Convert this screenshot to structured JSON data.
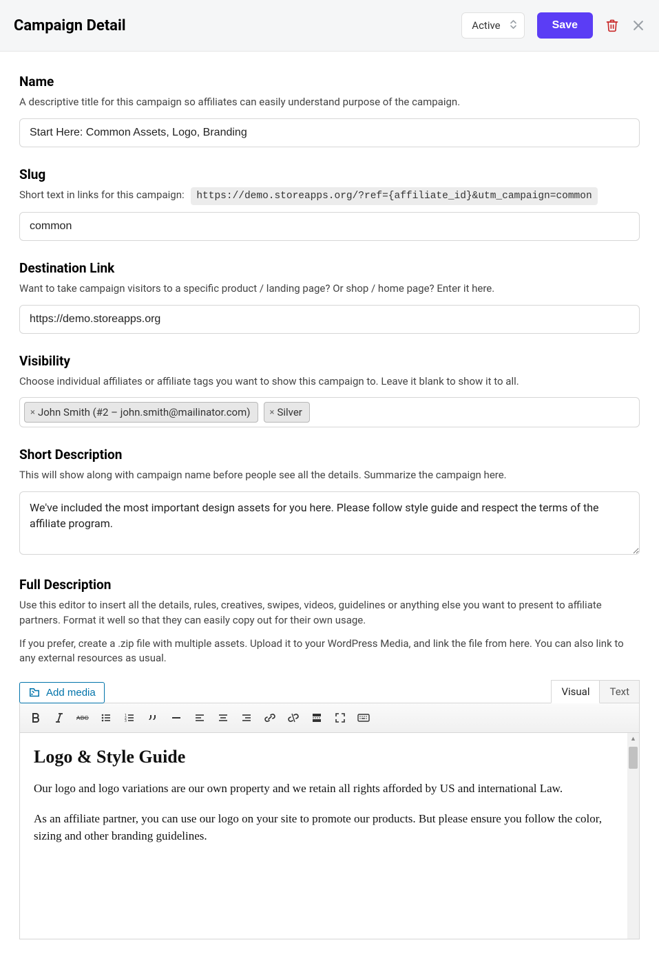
{
  "header": {
    "title": "Campaign Detail",
    "status": "Active",
    "save_label": "Save"
  },
  "name": {
    "label": "Name",
    "desc": "A descriptive title for this campaign so affiliates can easily understand purpose of the campaign.",
    "value": "Start Here: Common Assets, Logo, Branding"
  },
  "slug": {
    "label": "Slug",
    "desc_prefix": "Short text in links for this campaign:",
    "url_preview": "https://demo.storeapps.org/?ref={affiliate_id}&utm_campaign=common",
    "value": "common"
  },
  "destination": {
    "label": "Destination Link",
    "desc": "Want to take campaign visitors to a specific product / landing page? Or shop / home page? Enter it here.",
    "value": "https://demo.storeapps.org"
  },
  "visibility": {
    "label": "Visibility",
    "desc": "Choose individual affiliates or affiliate tags you want to show this campaign to. Leave it blank to show it to all.",
    "tags": [
      "John Smith (#2 – john.smith@mailinator.com)",
      "Silver"
    ]
  },
  "short_desc": {
    "label": "Short Description",
    "desc": "This will show along with campaign name before people see all the details. Summarize the campaign here.",
    "value": "We've included the most important design assets for you here. Please follow style guide and respect the terms of the affiliate program."
  },
  "full_desc": {
    "label": "Full Description",
    "desc1": "Use this editor to insert all the details, rules, creatives, swipes, videos, guidelines or anything else you want to present to affiliate partners. Format it well so that they can easily copy out for their own usage.",
    "desc2": "If you prefer, create a .zip file with multiple assets. Upload it to your WordPress Media, and link the file from here. You can also link to any external resources as usual.",
    "add_media_label": "Add media",
    "tabs": {
      "visual": "Visual",
      "text": "Text"
    },
    "body": {
      "heading": "Logo & Style Guide",
      "p1": "Our logo and logo variations are our own property and we retain all rights afforded by US and international Law.",
      "p2": "As an affiliate partner, you can use our logo on your site to promote our products. But please ensure you follow the color, sizing and other branding guidelines."
    }
  }
}
